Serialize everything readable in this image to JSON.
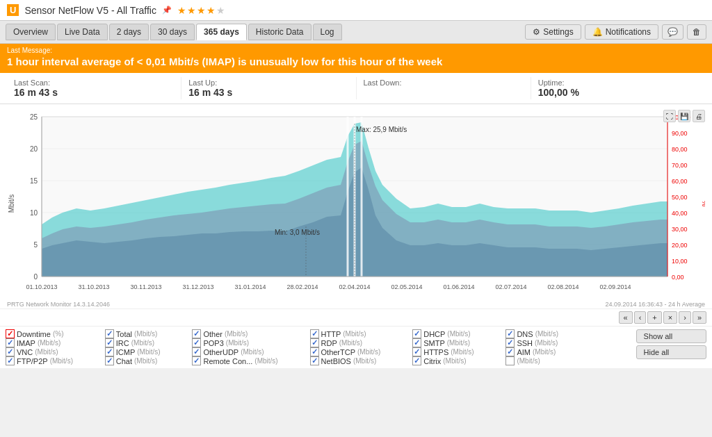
{
  "titlebar": {
    "logo": "U",
    "title": "Sensor NetFlow V5 - All Traffic",
    "pin_icon": "📌",
    "stars": "★★★★★"
  },
  "nav": {
    "tabs": [
      {
        "label": "Overview",
        "active": false
      },
      {
        "label": "Live Data",
        "active": false
      },
      {
        "label": "2 days",
        "active": false
      },
      {
        "label": "30 days",
        "active": false
      },
      {
        "label": "365 days",
        "active": true
      },
      {
        "label": "Historic Data",
        "active": false
      },
      {
        "label": "Log",
        "active": false
      }
    ],
    "buttons": [
      {
        "label": "Settings",
        "icon": "⚙"
      },
      {
        "label": "Notifications",
        "icon": "🔔"
      },
      {
        "label": "",
        "icon": "💬"
      },
      {
        "label": "",
        "icon": "🗑"
      }
    ]
  },
  "alert": {
    "label": "Last Message:",
    "message": "1 hour interval average of < 0,01 Mbit/s (IMAP) is unusually low for this hour of the week"
  },
  "stats": {
    "last_scan_label": "Last Scan:",
    "last_scan_value": "16 m 43 s",
    "last_up_label": "Last Up:",
    "last_up_value": "16 m 43 s",
    "last_down_label": "Last Down:",
    "last_down_value": "",
    "uptime_label": "Uptime:",
    "uptime_value": "100,00  %"
  },
  "chart": {
    "y_axis_left": [
      "25",
      "20",
      "15",
      "10",
      "5",
      "0"
    ],
    "y_axis_right": [
      "100,00",
      "90,00",
      "80,00",
      "70,00",
      "60,00",
      "50,00",
      "40,00",
      "30,00",
      "20,00",
      "10,00",
      "0,00"
    ],
    "y_label_left": "Mbit/s",
    "y_label_right": "%",
    "x_labels": [
      "01.10.2013",
      "31.10.2013",
      "30.11.2013",
      "31.12.2013",
      "31.01.2014",
      "28.02.2014",
      "02.04.2014",
      "02.05.2014",
      "01.06.2014",
      "02.07.2014",
      "02.08.2014",
      "02.09.2014"
    ],
    "max_label": "Max: 25,9 Mbit/s",
    "min_label": "Min: 3,0 Mbit/s",
    "footer_left": "PRTG Network Monitor 14.3.14.2046",
    "footer_right": "24.09.2014 16:36:43 - 24 h Average"
  },
  "pagination": {
    "buttons": [
      "«",
      "‹",
      "+",
      "×",
      "›",
      "»"
    ]
  },
  "legend": {
    "columns": [
      {
        "items": [
          {
            "checked": true,
            "check_color": "red",
            "name": "Downtime",
            "unit": "(%)"
          },
          {
            "checked": true,
            "check_color": "blue",
            "name": "IMAP",
            "unit": "(Mbit/s)"
          },
          {
            "checked": true,
            "check_color": "blue",
            "name": "VNC",
            "unit": "(Mbit/s)"
          },
          {
            "checked": true,
            "check_color": "blue",
            "name": "FTP/P2P",
            "unit": "(Mbit/s)"
          }
        ]
      },
      {
        "items": [
          {
            "checked": true,
            "check_color": "blue",
            "name": "Total",
            "unit": "(Mbit/s)"
          },
          {
            "checked": true,
            "check_color": "blue",
            "name": "IRC",
            "unit": "(Mbit/s)"
          },
          {
            "checked": true,
            "check_color": "blue",
            "name": "ICMP",
            "unit": "(Mbit/s)"
          },
          {
            "checked": true,
            "check_color": "blue",
            "name": "Chat",
            "unit": "(Mbit/s)"
          }
        ]
      },
      {
        "items": [
          {
            "checked": true,
            "check_color": "blue",
            "name": "Other",
            "unit": "(Mbit/s)"
          },
          {
            "checked": true,
            "check_color": "blue",
            "name": "POP3",
            "unit": "(Mbit/s)"
          },
          {
            "checked": true,
            "check_color": "blue",
            "name": "OtherUDP",
            "unit": "(Mbit/s)"
          },
          {
            "checked": true,
            "check_color": "blue",
            "name": "Remote Con...",
            "unit": "(Mbit/s)"
          }
        ]
      },
      {
        "items": [
          {
            "checked": true,
            "check_color": "blue",
            "name": "HTTP",
            "unit": "(Mbit/s)"
          },
          {
            "checked": true,
            "check_color": "blue",
            "name": "RDP",
            "unit": "(Mbit/s)"
          },
          {
            "checked": true,
            "check_color": "blue",
            "name": "OtherTCP",
            "unit": "(Mbit/s)"
          },
          {
            "checked": true,
            "check_color": "blue",
            "name": "NetBIOS",
            "unit": "(Mbit/s)"
          }
        ]
      },
      {
        "items": [
          {
            "checked": true,
            "check_color": "blue",
            "name": "DHCP",
            "unit": "(Mbit/s)"
          },
          {
            "checked": true,
            "check_color": "blue",
            "name": "SMTP",
            "unit": "(Mbit/s)"
          },
          {
            "checked": true,
            "check_color": "blue",
            "name": "HTTPS",
            "unit": "(Mbit/s)"
          },
          {
            "checked": true,
            "check_color": "blue",
            "name": "Citrix",
            "unit": "(Mbit/s)"
          }
        ]
      },
      {
        "items": [
          {
            "checked": true,
            "check_color": "blue",
            "name": "DNS",
            "unit": "(Mbit/s)"
          },
          {
            "checked": true,
            "check_color": "blue",
            "name": "SSH",
            "unit": "(Mbit/s)"
          },
          {
            "checked": true,
            "check_color": "blue",
            "name": "AIM",
            "unit": "(Mbit/s)"
          },
          {
            "checked": false,
            "check_color": "blue",
            "name": "",
            "unit": "(Mbit/s)"
          }
        ]
      },
      {
        "items": [
          {
            "checked": false,
            "check_color": "blue",
            "name": "Show all",
            "unit": ""
          },
          {
            "checked": false,
            "check_color": "blue",
            "name": "Hide all",
            "unit": ""
          }
        ]
      }
    ]
  }
}
